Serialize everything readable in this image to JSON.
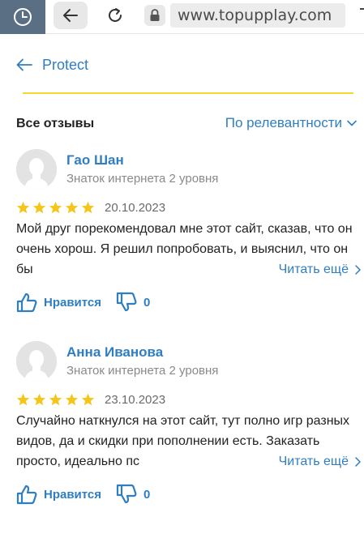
{
  "browser": {
    "url": "www.topupplay.com"
  },
  "header": {
    "title": "Protect"
  },
  "reviews_section": {
    "title": "Все отзывы",
    "sort_label": "По релевантности"
  },
  "reviews": [
    {
      "name": "Гао Шан",
      "level": "Знаток интернета 2 уровня",
      "stars": 5,
      "date": "20.10.2023",
      "text": "Мой друг порекомендовал мне этот сайт, сказав, что он очень хорош. Я решил попробовать, и выяснил, что он бы",
      "read_more": "Читать ещё",
      "like_label": "Нравится",
      "dislike_count": "0"
    },
    {
      "name": "Анна Иванова",
      "level": "Знаток интернета 2 уровня",
      "stars": 5,
      "date": "23.10.2023",
      "text": "Случайно наткнулся на этот сайт, тут полно игр разных видов, да и скидки при пополнении есть. Заказать просто, идеально пс",
      "read_more": "Читать ещё",
      "like_label": "Нравится",
      "dislike_count": "0"
    }
  ],
  "colors": {
    "accent": "#2f7ec2",
    "star": "#f5c518",
    "divider": "#f2d635",
    "tab_button": "#5a6e84"
  }
}
